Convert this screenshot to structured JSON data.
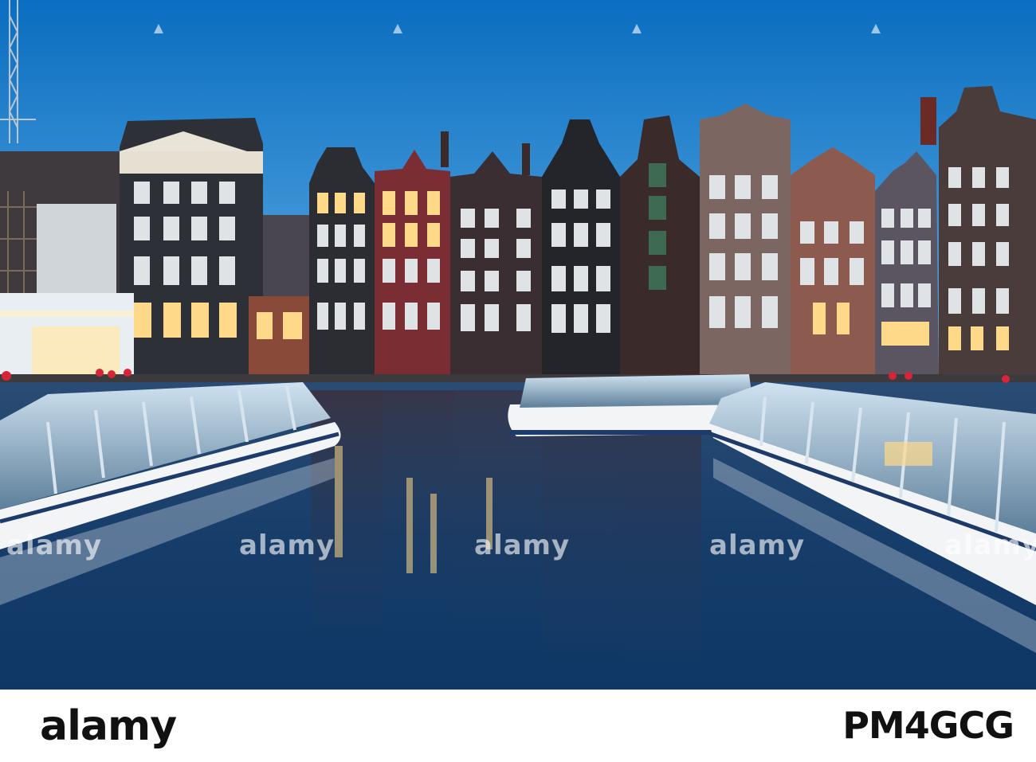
{
  "photo": {
    "subject": "Amsterdam canal houses with tour boats",
    "colors": {
      "sky_top": "#0b6fc1",
      "sky_bottom": "#5aa8e0",
      "water": "#123a66",
      "boat_hull": "#f2f4f6",
      "boat_glass": "#6f8fa8",
      "window_light": "#ffd98a"
    }
  },
  "watermarks": {
    "label": "alamy",
    "positions": [
      "top-left",
      "top-center",
      "top-right",
      "mid-left",
      "mid-center",
      "mid-right"
    ]
  },
  "footer": {
    "brand": "alamy",
    "image_id": "PM4GCG"
  }
}
